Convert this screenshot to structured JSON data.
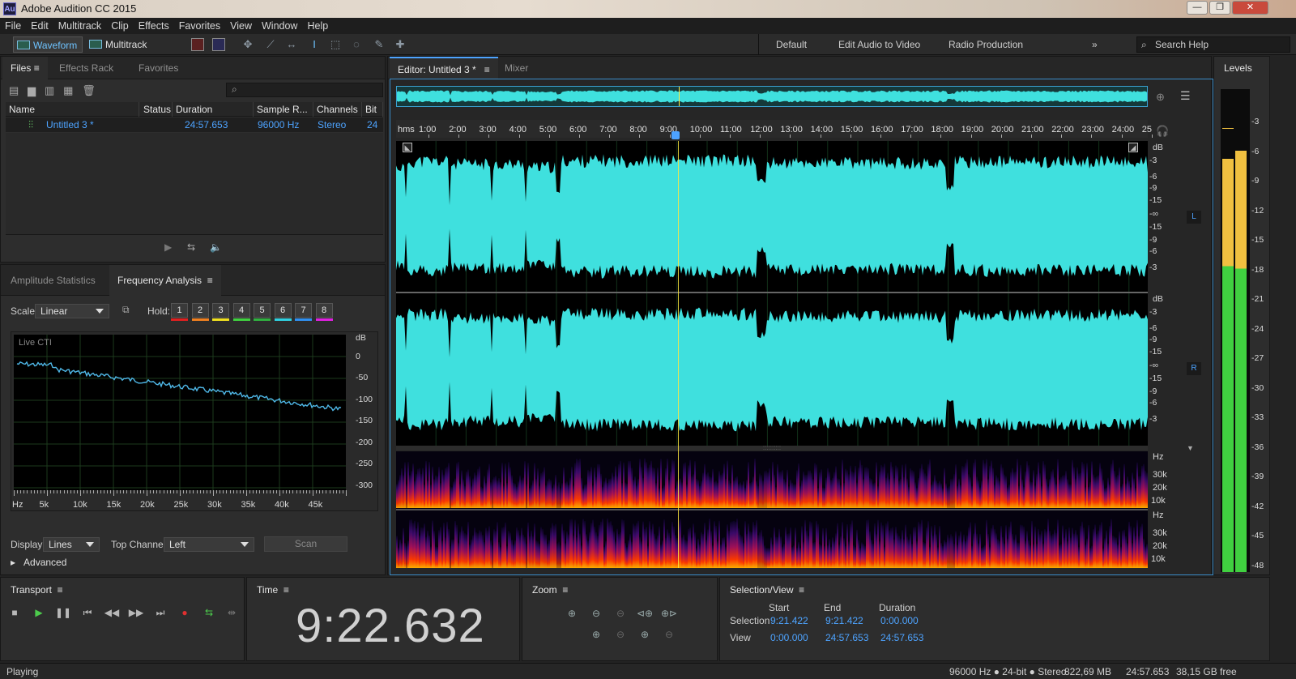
{
  "app": {
    "title": "Adobe Audition CC 2015",
    "logo": "Au"
  },
  "menu": [
    "File",
    "Edit",
    "Multitrack",
    "Clip",
    "Effects",
    "Favorites",
    "View",
    "Window",
    "Help"
  ],
  "toolbar": {
    "waveform_label": "Waveform",
    "multitrack_label": "Multitrack",
    "workspaces": [
      "Default",
      "Edit Audio to Video",
      "Radio Production"
    ],
    "search_help": "Search Help"
  },
  "files_panel": {
    "tabs": [
      "Files",
      "Effects Rack",
      "Favorites"
    ],
    "columns": [
      "Name",
      "Status",
      "Duration",
      "Sample R...",
      "Channels",
      "Bit D"
    ],
    "rows": [
      {
        "name": "Untitled 3 *",
        "status": "",
        "duration": "24:57.653",
        "sample_rate": "96000 Hz",
        "channels": "Stereo",
        "bit_depth": "24"
      }
    ]
  },
  "analysis_panel": {
    "tabs": [
      "Amplitude Statistics",
      "Frequency Analysis"
    ],
    "scale_label": "Scale:",
    "scale_value": "Linear",
    "hold_label": "Hold:",
    "hold_buttons": [
      "1",
      "2",
      "3",
      "4",
      "5",
      "6",
      "7",
      "8"
    ],
    "hold_colors": [
      "#e02020",
      "#f08020",
      "#f0e020",
      "#40d040",
      "#30b040",
      "#30d0e0",
      "#3090f0",
      "#e020e0"
    ],
    "graph_label": "Live CTI",
    "db_labels": [
      "dB",
      "0",
      "-50",
      "-100",
      "-150",
      "-200",
      "-250",
      "-300"
    ],
    "hz_labels": [
      "Hz",
      "5k",
      "10k",
      "15k",
      "20k",
      "25k",
      "30k",
      "35k",
      "40k",
      "45k"
    ],
    "display_label": "Display:",
    "display_value": "Lines",
    "top_channel_label": "Top Channel:",
    "top_channel_value": "Left",
    "scan_label": "Scan",
    "advanced_label": "Advanced"
  },
  "editor": {
    "tabs": [
      "Editor: Untitled 3 *",
      "Mixer"
    ],
    "ruler_unit": "hms",
    "ruler_labels": [
      "1:00",
      "2:00",
      "3:00",
      "4:00",
      "5:00",
      "6:00",
      "7:00",
      "8:00",
      "9:00",
      "10:00",
      "11:00",
      "12:00",
      "13:00",
      "14:00",
      "15:00",
      "16:00",
      "17:00",
      "18:00",
      "19:00",
      "20:00",
      "21:00",
      "22:00",
      "23:00",
      "24:00",
      "25"
    ],
    "db_scale_left": [
      "dB",
      "-3",
      "-6",
      "-9",
      "-15",
      "-∞",
      "-15",
      "-9",
      "-6",
      "-3"
    ],
    "db_scale_right": [
      "dB",
      "-3",
      "-6",
      "-9",
      "-15",
      "-∞",
      "-15",
      "-9",
      "-6",
      "-3"
    ],
    "channel_left": "L",
    "channel_right": "R",
    "spectral_labels": [
      "Hz",
      "30k",
      "20k",
      "10k"
    ],
    "waveform_color": "#3fe0de"
  },
  "levels": {
    "title": "Levels",
    "scale": [
      "-3",
      "-6",
      "-9",
      "-12",
      "-15",
      "-18",
      "-21",
      "-24",
      "-27",
      "-30",
      "-33",
      "-36",
      "-39",
      "-42",
      "-45",
      "-48"
    ]
  },
  "transport": {
    "title": "Transport"
  },
  "time": {
    "title": "Time",
    "value": "9:22.632"
  },
  "zoom": {
    "title": "Zoom"
  },
  "selection": {
    "title": "Selection/View",
    "headers": [
      "Start",
      "End",
      "Duration"
    ],
    "selection_label": "Selection",
    "selection_values": [
      "9:21.422",
      "9:21.422",
      "0:00.000"
    ],
    "view_label": "View",
    "view_values": [
      "0:00.000",
      "24:57.653",
      "24:57.653"
    ]
  },
  "status": {
    "state": "Playing",
    "format": "96000 Hz ● 24-bit ● Stereo",
    "size": "822,69 MB",
    "duration": "24:57.653",
    "free": "38,15 GB free"
  }
}
